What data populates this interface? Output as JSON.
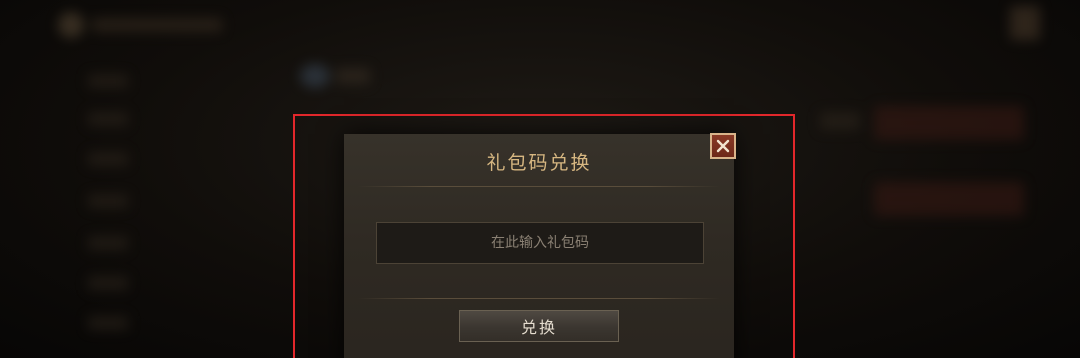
{
  "dialog": {
    "title": "礼包码兑换",
    "input_placeholder": "在此输入礼包码",
    "input_value": "",
    "redeem_label": "兑换",
    "close_icon": "close-icon"
  },
  "colors": {
    "highlight_border": "#e2272b",
    "title_gold": "#d7b781",
    "close_button_fill": "#7a2f1e"
  }
}
